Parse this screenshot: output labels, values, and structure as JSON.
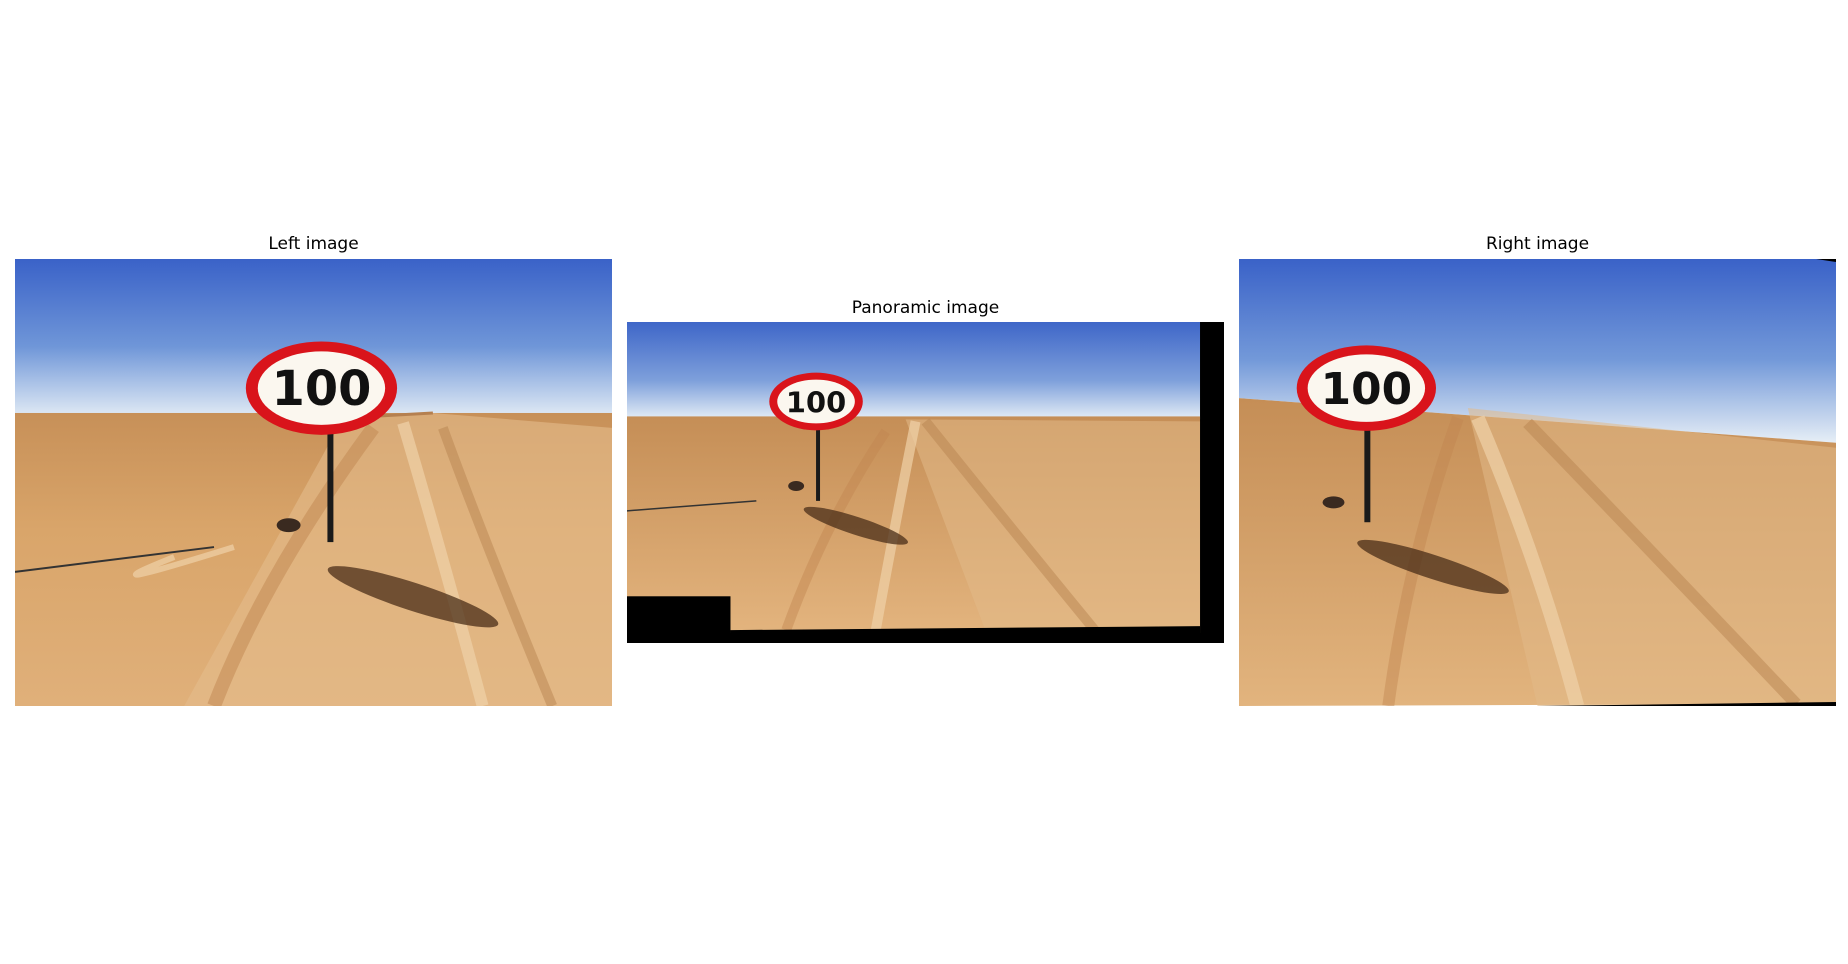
{
  "panels": [
    {
      "title": "Left image",
      "sign_text": "100"
    },
    {
      "title": "Panoramic image",
      "sign_text": "100"
    },
    {
      "title": "Right image",
      "sign_text": "100"
    }
  ],
  "colors": {
    "sky_top": "#3a62c8",
    "sky_horizon": "#dfe9f4",
    "sand": "#d39a5c",
    "sand_dark": "#b7783c",
    "sign_ring": "#d9141b",
    "background": "#ffffff",
    "pano_fill": "#000000"
  }
}
